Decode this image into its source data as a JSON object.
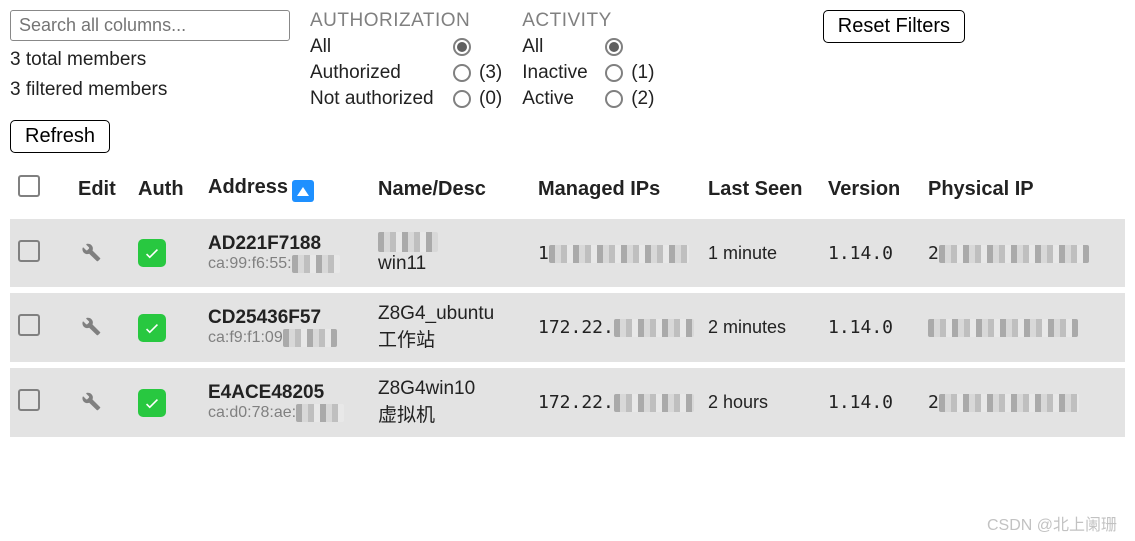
{
  "search": {
    "placeholder": "Search all columns..."
  },
  "stats": {
    "total_line": "3 total members",
    "filtered_line": "3 filtered members"
  },
  "filters": {
    "authorization": {
      "heading": "AUTHORIZATION",
      "options": [
        {
          "label": "All",
          "selected": true,
          "count": ""
        },
        {
          "label": "Authorized",
          "selected": false,
          "count": "(3)"
        },
        {
          "label": "Not authorized",
          "selected": false,
          "count": "(0)"
        }
      ]
    },
    "activity": {
      "heading": "ACTIVITY",
      "options": [
        {
          "label": "All",
          "selected": true,
          "count": ""
        },
        {
          "label": "Inactive",
          "selected": false,
          "count": "(1)"
        },
        {
          "label": "Active",
          "selected": false,
          "count": "(2)"
        }
      ]
    }
  },
  "buttons": {
    "reset_filters": "Reset Filters",
    "refresh": "Refresh"
  },
  "columns": {
    "edit": "Edit",
    "auth": "Auth",
    "address": "Address",
    "name_desc": "Name/Desc",
    "managed_ips": "Managed IPs",
    "last_seen": "Last Seen",
    "version": "Version",
    "physical_ip": "Physical IP"
  },
  "rows": [
    {
      "checked": false,
      "authorized": true,
      "address": "AD221F7188",
      "mac_prefix": "ca:99:f6:55:",
      "name": "",
      "desc": "win11",
      "managed_ip_prefix": "1",
      "last_seen": "1 minute",
      "version": "1.14.0",
      "physical_ip_prefix": "2"
    },
    {
      "checked": false,
      "authorized": true,
      "address": "CD25436F57",
      "mac_prefix": "ca:f9:f1:09",
      "name": "Z8G4_ubuntu",
      "desc": "工作站",
      "managed_ip_prefix": "172.22.",
      "last_seen": "2 minutes",
      "version": "1.14.0",
      "physical_ip_prefix": ""
    },
    {
      "checked": false,
      "authorized": true,
      "address": "E4ACE48205",
      "mac_prefix": "ca:d0:78:ae:",
      "name": "Z8G4win10",
      "desc": "虚拟机",
      "managed_ip_prefix": "172.22.",
      "last_seen": "2 hours",
      "version": "1.14.0",
      "physical_ip_prefix": "2"
    }
  ],
  "watermark": "CSDN @北上阑珊"
}
